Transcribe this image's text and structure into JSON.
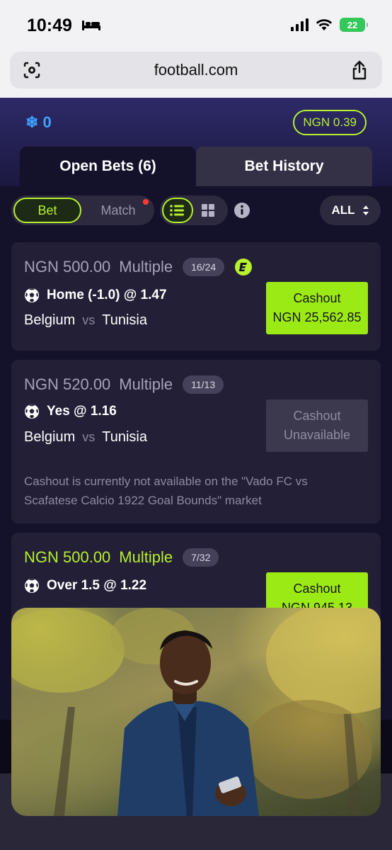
{
  "status_bar": {
    "time": "10:49",
    "battery": "22"
  },
  "browser": {
    "url": "football.com"
  },
  "header": {
    "free_bets": "0",
    "balance": "NGN 0.39"
  },
  "tabs": [
    {
      "label": "Open Bets (6)"
    },
    {
      "label": "Bet History"
    }
  ],
  "filters": {
    "bet": "Bet",
    "match": "Match",
    "all": "ALL"
  },
  "bets": [
    {
      "stake": "NGN 500.00",
      "type": "Multiple",
      "legs": "16/24",
      "selection": "Home (-1.0) @ 1.47",
      "home": "Belgium",
      "vs": "vs",
      "away": "Tunisia",
      "cashout_line1": "Cashout",
      "cashout_line2": "NGN 25,562.85",
      "cashout_available": true
    },
    {
      "stake": "NGN 520.00",
      "type": "Multiple",
      "legs": "11/13",
      "selection": "Yes @ 1.16",
      "home": "Belgium",
      "vs": "vs",
      "away": "Tunisia",
      "cashout_line1": "Cashout",
      "cashout_line2": "Unavailable",
      "cashout_available": false,
      "notice": "Cashout is currently not available on the \"Vado FC vs Scafatese Calcio 1922 Goal Bounds\" market"
    },
    {
      "stake": "NGN 500.00",
      "type": "Multiple",
      "legs": "7/32",
      "selection": "Over 1.5 @ 1.22",
      "cashout_line1": "Cashout",
      "cashout_line2": "NGN 945.13",
      "cashout_available": true
    }
  ],
  "colors": {
    "accent": "#b7f02d",
    "background": "#14112a",
    "card": "#231f37",
    "freebet": "#3fa1ff"
  }
}
